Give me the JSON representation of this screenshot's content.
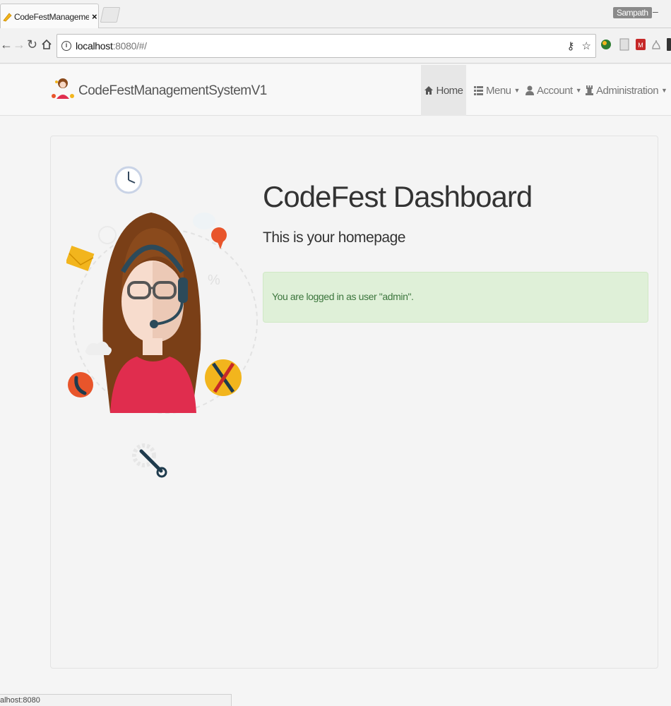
{
  "browser": {
    "tab_title": "CodeFestManagementSy",
    "profile_name": "Sampath",
    "url_host": "localhost",
    "url_rest": ":8080/#/",
    "status_url": "alhost:8080"
  },
  "navbar": {
    "brand": "CodeFestManagementSystemV1",
    "items": [
      {
        "label": "Home",
        "icon": "home-icon",
        "active": true
      },
      {
        "label": "Menu",
        "icon": "list-icon",
        "dropdown": true
      },
      {
        "label": "Account",
        "icon": "user-icon",
        "dropdown": true
      },
      {
        "label": "Administration",
        "icon": "tower-icon",
        "dropdown": true
      }
    ]
  },
  "main": {
    "title": "CodeFest Dashboard",
    "subtitle": "This is your homepage",
    "alert": "You are logged in as user \"admin\"."
  },
  "colors": {
    "alert_bg": "#dff0d8",
    "alert_text": "#3c763d",
    "navbar_bg": "#f8f8f8",
    "accent_orange": "#e8552b",
    "accent_yellow": "#f2b51d"
  }
}
